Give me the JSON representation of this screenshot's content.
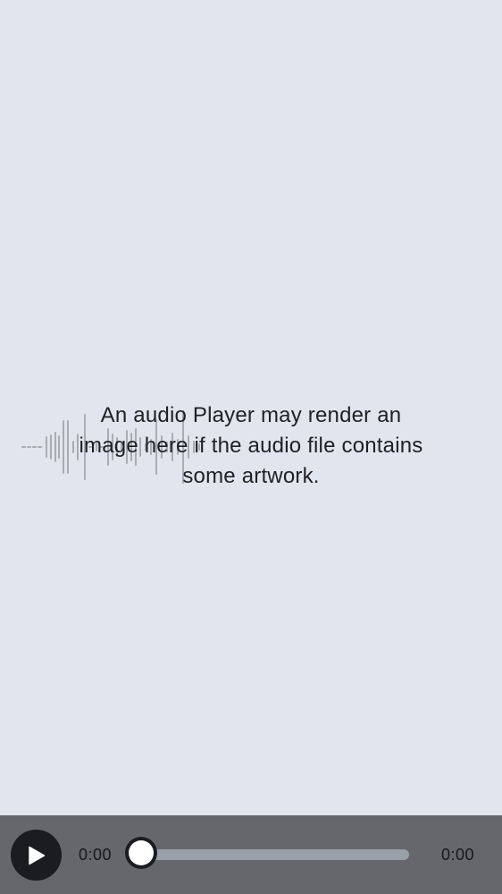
{
  "artwork_placeholder": {
    "message": "An audio Player may render an image here if the audio file contains some artwork."
  },
  "player": {
    "current_time": "0:00",
    "total_time": "0:00",
    "progress": 0,
    "play_icon": "play-icon"
  },
  "colors": {
    "background": "#e1e5ed",
    "control_bar": "#65676c",
    "button": "#1b1c20",
    "waveform": "#a9acb3"
  }
}
